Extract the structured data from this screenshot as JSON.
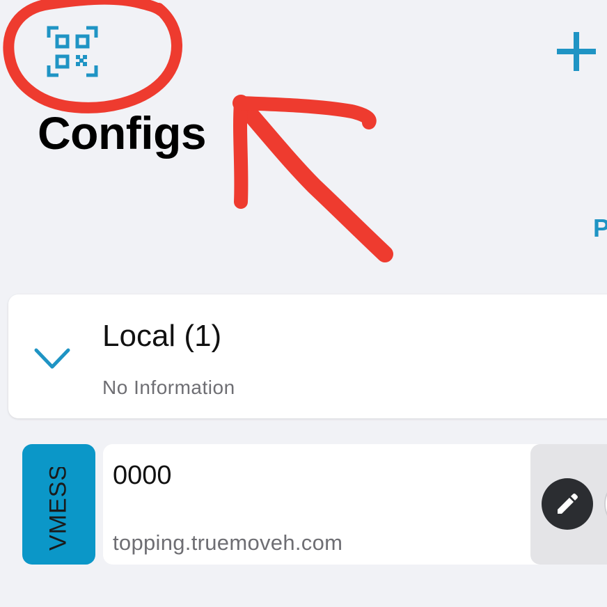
{
  "header": {
    "title": "Configs",
    "qr_icon": "qr-scan-icon",
    "add_icon": "plus-icon",
    "edge_letter": "P"
  },
  "group": {
    "title": "Local (1)",
    "subtitle": "No Information",
    "chevron_icon": "chevron-down-icon"
  },
  "server": {
    "protocol": "VMESS",
    "name": "0000",
    "host": "topping.truemoveh.com",
    "edit_icon": "pencil-icon"
  },
  "colors": {
    "accent": "#1f94c4",
    "badge": "#0b97c8",
    "background": "#f1f2f6",
    "annotation": "#ee3b2f"
  }
}
